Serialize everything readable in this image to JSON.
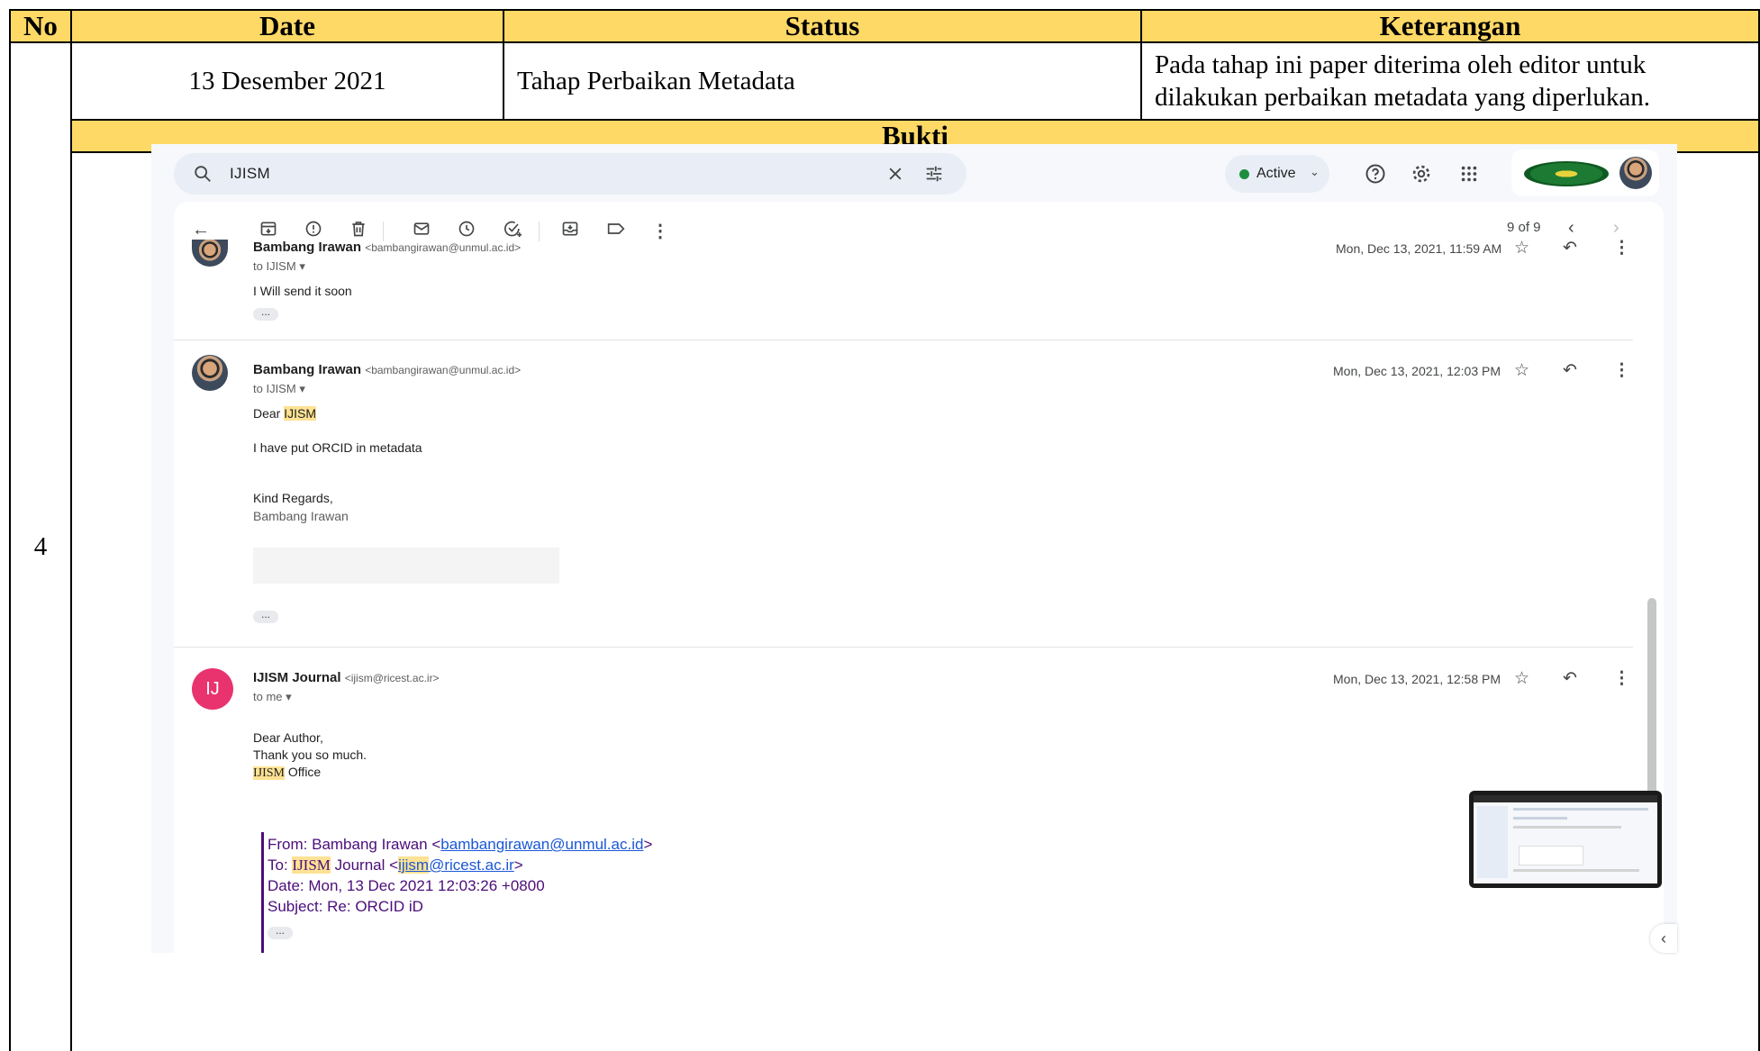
{
  "table": {
    "headers": {
      "no": "No",
      "date": "Date",
      "status": "Status",
      "keterangan": "Keterangan"
    },
    "row": {
      "no": "4",
      "date": "13 Desember 2021",
      "status": "Tahap Perbaikan Metadata",
      "keterangan_line1": "Pada tahap ini paper diterima oleh editor untuk",
      "keterangan_line2": "dilakukan perbaikan metadata yang diperlukan."
    },
    "bukti": "Bukti"
  },
  "gmail": {
    "search_value": "IJISM",
    "status_label": "Active",
    "page_counter": "9 of 9",
    "icons": [
      "search-icon",
      "close-icon",
      "filter-icon",
      "help-icon",
      "settings-icon",
      "apps-icon",
      "back-arrow-icon",
      "archive-icon",
      "report-spam-icon",
      "delete-icon",
      "mark-unread-icon",
      "snooze-icon",
      "add-task-icon",
      "move-to-icon",
      "label-icon",
      "more-icon",
      "prev-icon",
      "next-icon",
      "star-icon",
      "reply-icon"
    ],
    "messages": [
      {
        "sender": "Bambang Irawan",
        "email": "<bambangirawan@unmul.ac.id>",
        "to": "to IJISM",
        "date": "Mon, Dec 13, 2021, 11:59 AM",
        "body": "I Will send it soon"
      },
      {
        "sender": "Bambang Irawan",
        "email": "<bambangirawan@unmul.ac.id>",
        "to": "to IJISM",
        "date": "Mon, Dec 13, 2021, 12:03 PM",
        "greeting_prefix": "Dear ",
        "greeting_highlight": "IJISM",
        "line1": "I have put ORCID in metadata",
        "signoff": "Kind Regards,",
        "signature": "Bambang Irawan"
      },
      {
        "avatar_initials": "IJ",
        "sender": "IJISM Journal",
        "email": "<ijism@ricest.ac.ir>",
        "to": "to me",
        "date": "Mon, Dec 13, 2021, 12:58 PM",
        "line1": "Dear Author,",
        "line2": "Thank you so much.",
        "office_highlight": "IJISM",
        "office_suffix": " Office",
        "quote": {
          "from_prefix": "From: Bambang Irawan <",
          "from_email": "bambangirawan@unmul.ac.id",
          "from_suffix": ">",
          "to_prefix": "To: ",
          "to_highlight": "IJISM",
          "to_mid": " Journal <",
          "to_email_highlight": "ijism",
          "to_email_rest": "@ricest.ac.ir",
          "to_suffix": ">",
          "date": "Date: Mon, 13 Dec 2021 12:03:26 +0800",
          "subject": "Subject: Re: ORCID iD"
        }
      }
    ],
    "colors": {
      "header_fill": "#FFD966",
      "highlight": "#FDE293",
      "active_dot": "#1E8E3E",
      "ij_avatar": "#E8336F"
    }
  }
}
